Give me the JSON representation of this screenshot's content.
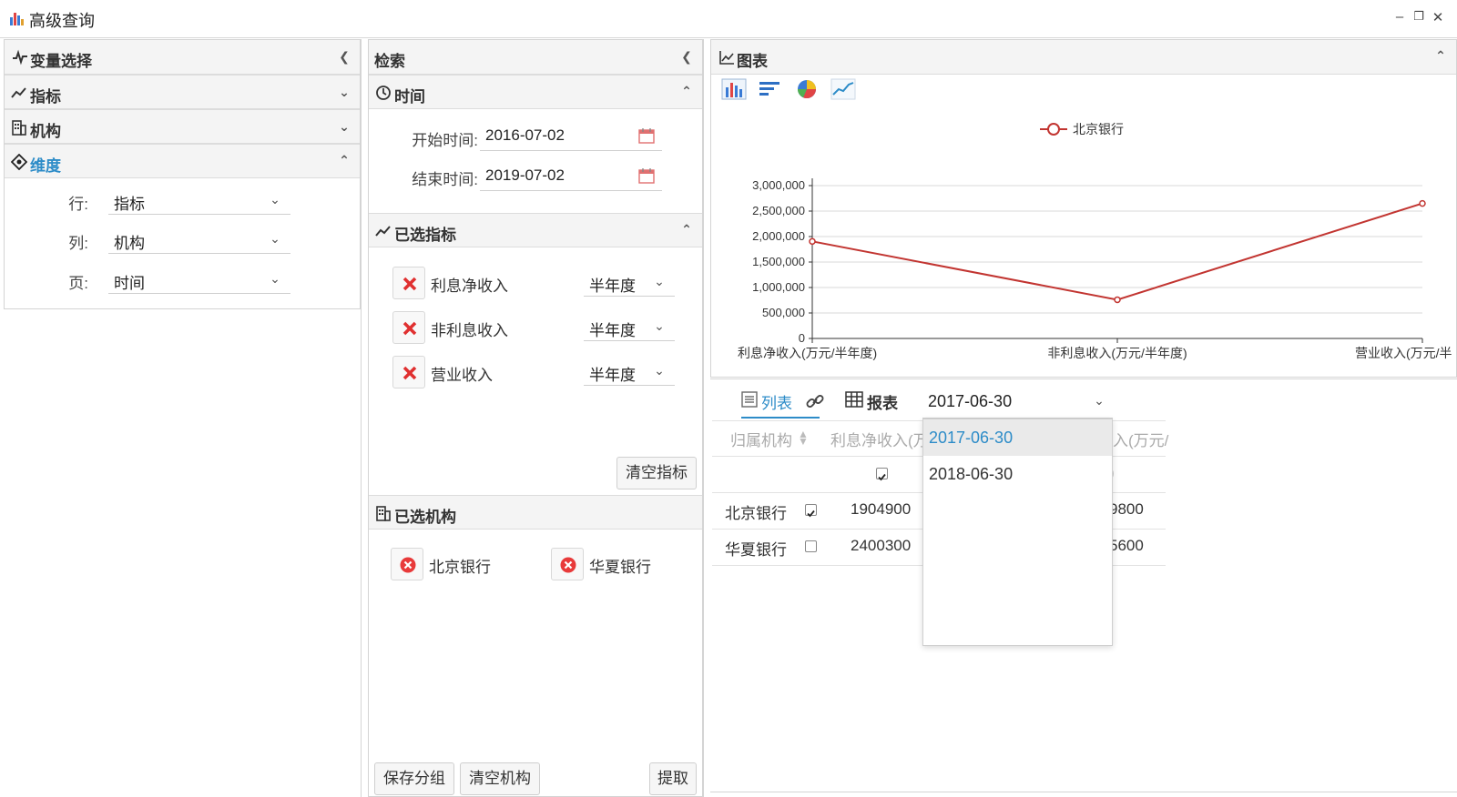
{
  "window": {
    "title": "高级查询",
    "minimize": "–",
    "restore": "❐",
    "close": "✕"
  },
  "variable_panel": {
    "title": "变量选择",
    "sections": [
      {
        "label": "指标",
        "expanded": false
      },
      {
        "label": "机构",
        "expanded": false
      },
      {
        "label": "维度",
        "expanded": true
      }
    ],
    "dimension": {
      "row_label": "行:",
      "row_value": "指标",
      "col_label": "列:",
      "col_value": "机构",
      "page_label": "页:",
      "page_value": "时间"
    }
  },
  "search_panel": {
    "title": "检索",
    "time_section": "时间",
    "start_label": "开始时间:",
    "start_value": "2016-07-02",
    "end_label": "结束时间:",
    "end_value": "2019-07-02",
    "indicator_section": "已选指标",
    "indicators": [
      {
        "name": "利息净收入",
        "period": "半年度"
      },
      {
        "name": "非利息收入",
        "period": "半年度"
      },
      {
        "name": "营业收入",
        "period": "半年度"
      }
    ],
    "clear_indicators": "清空指标",
    "org_section": "已选机构",
    "orgs": [
      "北京银行",
      "华夏银行"
    ],
    "save_group": "保存分组",
    "clear_orgs": "清空机构",
    "extract": "提取"
  },
  "chart_panel": {
    "title": "图表",
    "accent": "#c23531",
    "legend": "北京银行",
    "y_ticks": [
      "3,000,000",
      "2,500,000",
      "2,000,000",
      "1,500,000",
      "1,000,000",
      "500,000",
      "0"
    ],
    "x_labels": [
      "利息净收入(万元/半年度)",
      "非利息收入(万元/半年度)",
      "营业收入(万元/半"
    ]
  },
  "chart_data": {
    "type": "line",
    "categories": [
      "利息净收入(万元/半年度)",
      "非利息收入(万元/半年度)",
      "营业收入(万元/半年度)"
    ],
    "series": [
      {
        "name": "北京银行",
        "values": [
          1904900,
          760000,
          2650000
        ]
      }
    ],
    "ylim": [
      0,
      3000000
    ],
    "legend": "top-center",
    "grid": true
  },
  "table_panel": {
    "tab_list": "列表",
    "tab_report": "报表",
    "date_input": "2017-06-30",
    "dropdown_options": [
      "2017-06-30",
      "2018-06-30"
    ],
    "headers": [
      "归属机构",
      "利息净收入(万",
      "入(万元/"
    ],
    "header_partial_col3": ")",
    "rows": [
      {
        "org": "北京银行",
        "checked": true,
        "v1": "1904900",
        "v3": "9800"
      },
      {
        "org": "华夏银行",
        "checked": false,
        "v1": "2400300",
        "v3": "5600"
      }
    ]
  }
}
